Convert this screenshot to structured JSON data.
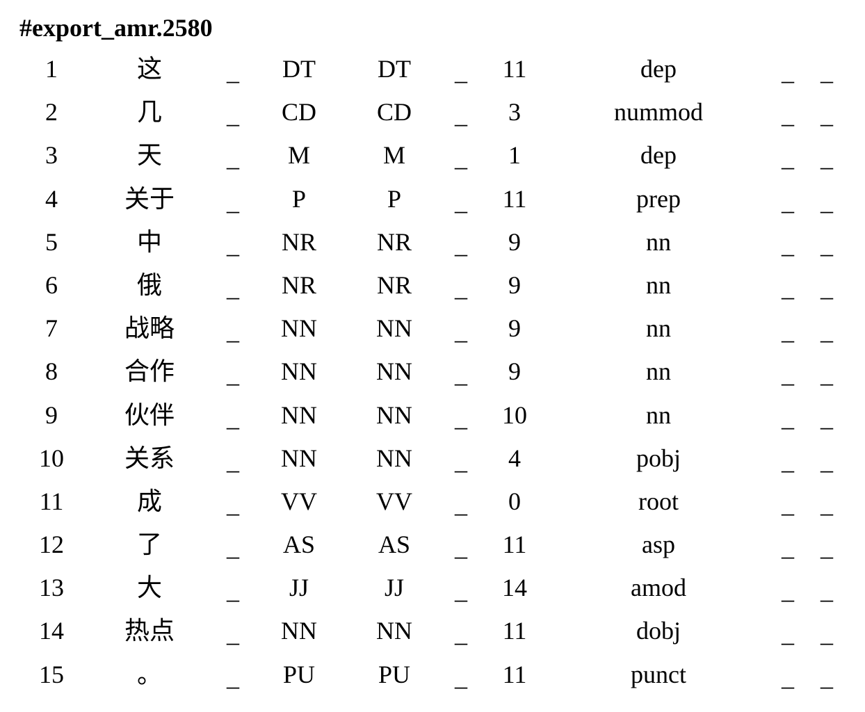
{
  "document": {
    "title": "#export_amr.2580"
  },
  "rows": [
    {
      "id": "1",
      "form": "这",
      "lemma": "_",
      "upos": "DT",
      "xpos": "DT",
      "feats": "_",
      "head": "11",
      "deprel": "dep",
      "deps": "_",
      "misc": "_"
    },
    {
      "id": "2",
      "form": "几",
      "lemma": "_",
      "upos": "CD",
      "xpos": "CD",
      "feats": "_",
      "head": "3",
      "deprel": "nummod",
      "deps": "_",
      "misc": "_"
    },
    {
      "id": "3",
      "form": "天",
      "lemma": "_",
      "upos": "M",
      "xpos": "M",
      "feats": "_",
      "head": "1",
      "deprel": "dep",
      "deps": "_",
      "misc": "_"
    },
    {
      "id": "4",
      "form": "关于",
      "lemma": "_",
      "upos": "P",
      "xpos": "P",
      "feats": "_",
      "head": "11",
      "deprel": "prep",
      "deps": "_",
      "misc": "_"
    },
    {
      "id": "5",
      "form": "中",
      "lemma": "_",
      "upos": "NR",
      "xpos": "NR",
      "feats": "_",
      "head": "9",
      "deprel": "nn",
      "deps": "_",
      "misc": "_"
    },
    {
      "id": "6",
      "form": "俄",
      "lemma": "_",
      "upos": "NR",
      "xpos": "NR",
      "feats": "_",
      "head": "9",
      "deprel": "nn",
      "deps": "_",
      "misc": "_"
    },
    {
      "id": "7",
      "form": "战略",
      "lemma": "_",
      "upos": "NN",
      "xpos": "NN",
      "feats": "_",
      "head": "9",
      "deprel": "nn",
      "deps": "_",
      "misc": "_"
    },
    {
      "id": "8",
      "form": "合作",
      "lemma": "_",
      "upos": "NN",
      "xpos": "NN",
      "feats": "_",
      "head": "9",
      "deprel": "nn",
      "deps": "_",
      "misc": "_"
    },
    {
      "id": "9",
      "form": "伙伴",
      "lemma": "_",
      "upos": "NN",
      "xpos": "NN",
      "feats": "_",
      "head": "10",
      "deprel": "nn",
      "deps": "_",
      "misc": "_"
    },
    {
      "id": "10",
      "form": "关系",
      "lemma": "_",
      "upos": "NN",
      "xpos": "NN",
      "feats": "_",
      "head": "4",
      "deprel": "pobj",
      "deps": "_",
      "misc": "_"
    },
    {
      "id": "11",
      "form": "成",
      "lemma": "_",
      "upos": "VV",
      "xpos": "VV",
      "feats": "_",
      "head": "0",
      "deprel": "root",
      "deps": "_",
      "misc": "_"
    },
    {
      "id": "12",
      "form": "了",
      "lemma": "_",
      "upos": "AS",
      "xpos": "AS",
      "feats": "_",
      "head": "11",
      "deprel": "asp",
      "deps": "_",
      "misc": "_"
    },
    {
      "id": "13",
      "form": "大",
      "lemma": "_",
      "upos": "JJ",
      "xpos": "JJ",
      "feats": "_",
      "head": "14",
      "deprel": "amod",
      "deps": "_",
      "misc": "_"
    },
    {
      "id": "14",
      "form": "热点",
      "lemma": "_",
      "upos": "NN",
      "xpos": "NN",
      "feats": "_",
      "head": "11",
      "deprel": "dobj",
      "deps": "_",
      "misc": "_"
    },
    {
      "id": "15",
      "form": "。",
      "lemma": "_",
      "upos": "PU",
      "xpos": "PU",
      "feats": "_",
      "head": "11",
      "deprel": "punct",
      "deps": "_",
      "misc": "_"
    }
  ]
}
